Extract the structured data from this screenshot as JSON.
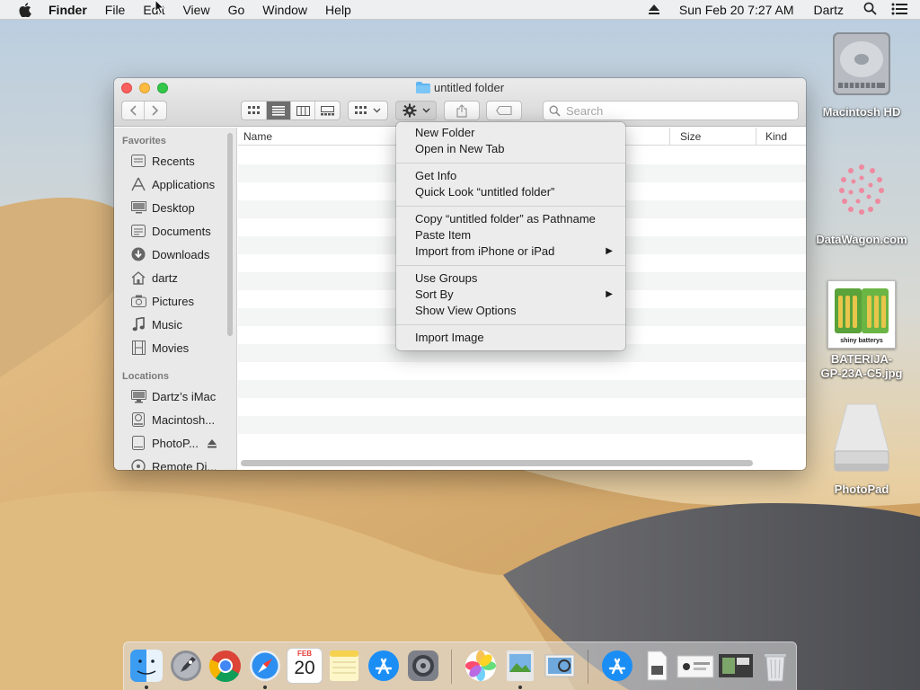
{
  "menubar": {
    "app": "Finder",
    "items": [
      "File",
      "Edit",
      "View",
      "Go",
      "Window",
      "Help"
    ],
    "datetime": "Sun Feb 20  7:27 AM",
    "user": "Dartz"
  },
  "desktop": {
    "icons": [
      {
        "label": "Macintosh HD",
        "icon": "hard-drive-icon"
      },
      {
        "label": "DataWagon.com",
        "icon": "flower-image-icon"
      },
      {
        "label": "BATERIJA-GP-23A-C5.jpg",
        "label_line1": "BATERIJA-",
        "label_line2": "GP-23A-C5.jpg",
        "icon": "battery-photo-thumbnail",
        "thumbnail_text": "shiny batterys"
      },
      {
        "label": "PhotoPad",
        "icon": "external-drive-icon"
      }
    ]
  },
  "finder": {
    "title": "untitled folder",
    "search_placeholder": "Search",
    "columns": {
      "name": "Name",
      "size": "Size",
      "kind": "Kind"
    },
    "sidebar": {
      "favorites_header": "Favorites",
      "favorites": [
        {
          "label": "Recents",
          "icon": "clock-icon"
        },
        {
          "label": "Applications",
          "icon": "applications-icon"
        },
        {
          "label": "Desktop",
          "icon": "desktop-icon"
        },
        {
          "label": "Documents",
          "icon": "document-icon"
        },
        {
          "label": "Downloads",
          "icon": "download-icon"
        },
        {
          "label": "dartz",
          "icon": "home-icon"
        },
        {
          "label": "Pictures",
          "icon": "camera-icon"
        },
        {
          "label": "Music",
          "icon": "music-note-icon"
        },
        {
          "label": "Movies",
          "icon": "film-icon"
        }
      ],
      "locations_header": "Locations",
      "locations": [
        {
          "label": "Dartz’s iMac",
          "icon": "computer-icon"
        },
        {
          "label": "Macintosh...",
          "icon": "disk-icon"
        },
        {
          "label": "PhotoP...",
          "icon": "drive-icon"
        },
        {
          "label": "Remote Di...",
          "icon": "remote-disc-icon"
        }
      ]
    }
  },
  "context_menu": {
    "groups": [
      [
        "New Folder",
        "Open in New Tab"
      ],
      [
        "Get Info",
        "Quick Look “untitled folder”"
      ],
      [
        "Copy “untitled folder” as Pathname",
        "Paste Item",
        "Import from iPhone or iPad"
      ],
      [
        "Use Groups",
        "Sort By",
        "Show View Options"
      ],
      [
        "Import Image"
      ]
    ],
    "submenu_items": [
      "Import from iPhone or iPad",
      "Sort By"
    ]
  },
  "dock": {
    "apps": [
      "Finder",
      "Launchpad",
      "Chrome",
      "Safari",
      "Calendar",
      "Notes",
      "App Store",
      "System Preferences",
      "Photos",
      "Preview",
      "iPhoto",
      "App Store",
      "File",
      "Photo",
      "Screen",
      "Trash"
    ],
    "calendar": {
      "month": "FEB",
      "day": "20"
    }
  },
  "colors": {
    "accent": "#2f7ff5",
    "close": "#fc605c",
    "minimize": "#fdbc40",
    "zoom": "#34c84a",
    "folder": "#5fb6f0"
  }
}
